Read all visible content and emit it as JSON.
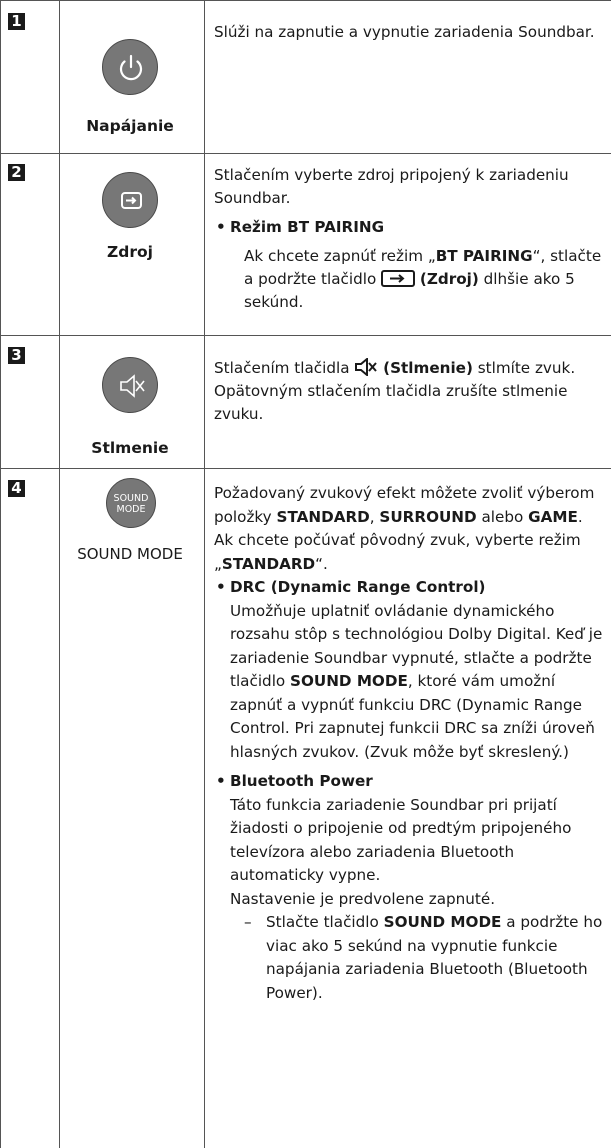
{
  "rows": [
    {
      "num": "1",
      "button_label": "Napájanie",
      "desc": "Slúži na zapnutie a vypnutie zariadenia Soundbar."
    },
    {
      "num": "2",
      "button_label": "Zdroj",
      "desc": "Stlačením vyberte zdroj pripojený k zariadeniu Soundbar.",
      "bullet_title": "Režim BT PAIRING",
      "sub_pre": "Ak chcete zapnúť režim „",
      "sub_bold": "BT PAIRING",
      "sub_mid": "“, stlačte a podržte tlačidlo",
      "sub_bold2": "(Zdroj)",
      "sub_post": "dlhšie ako 5 sekúnd."
    },
    {
      "num": "3",
      "button_label": "Stlmenie",
      "desc_pre": "Stlačením tlačidla",
      "desc_bold": "(Stlmenie)",
      "desc_post": "stlmíte zvuk. Opätovným stlačením tlačidla zrušíte stlmenie zvuku."
    },
    {
      "num": "4",
      "button_text_1": "SOUND",
      "button_text_2": "MODE",
      "button_label": "SOUND MODE",
      "p1_pre": "Požadovaný zvukový efekt môžete zvoliť výberom položky",
      "p1_b1": "STANDARD",
      "p1_sep": ",",
      "p1_b2": "SURROUND",
      "p1_mid": "alebo",
      "p1_b3": "GAME",
      "p1_end": ".",
      "p2_pre": "Ak chcete počúvať pôvodný zvuk, vyberte režim „",
      "p2_bold": "STANDARD",
      "p2_end": "“.",
      "drc_title": "DRC (Dynamic Range Control)",
      "drc_pre": "Umožňuje uplatniť ovládanie dynamického rozsahu stôp s technológiou Dolby Digital. Keď je zariadenie Soundbar vypnuté, stlačte a podržte tlačidlo",
      "drc_bold": "SOUND MODE",
      "drc_post": ", ktoré vám umožní zapnúť a vypnúť funkciu DRC (Dynamic Range Control. Pri zapnutej funkcii DRC sa zníži úroveň hlasných zvukov. (Zvuk môže byť skreslený.)",
      "bt_title": "Bluetooth Power",
      "bt_text": "Táto funkcia zariadenie Soundbar pri prijatí žiadosti o pripojenie od predtým pripojeného televízora alebo zariadenia Bluetooth automaticky vypne.",
      "bt_default": "Nastavenie je predvolene zapnuté.",
      "dash_pre": "Stlačte tlačidlo",
      "dash_bold": "SOUND MODE",
      "dash_post": "a podržte ho viac ako 5 sekúnd na vypnutie funkcie napájania zariadenia Bluetooth (Bluetooth Power)."
    }
  ]
}
